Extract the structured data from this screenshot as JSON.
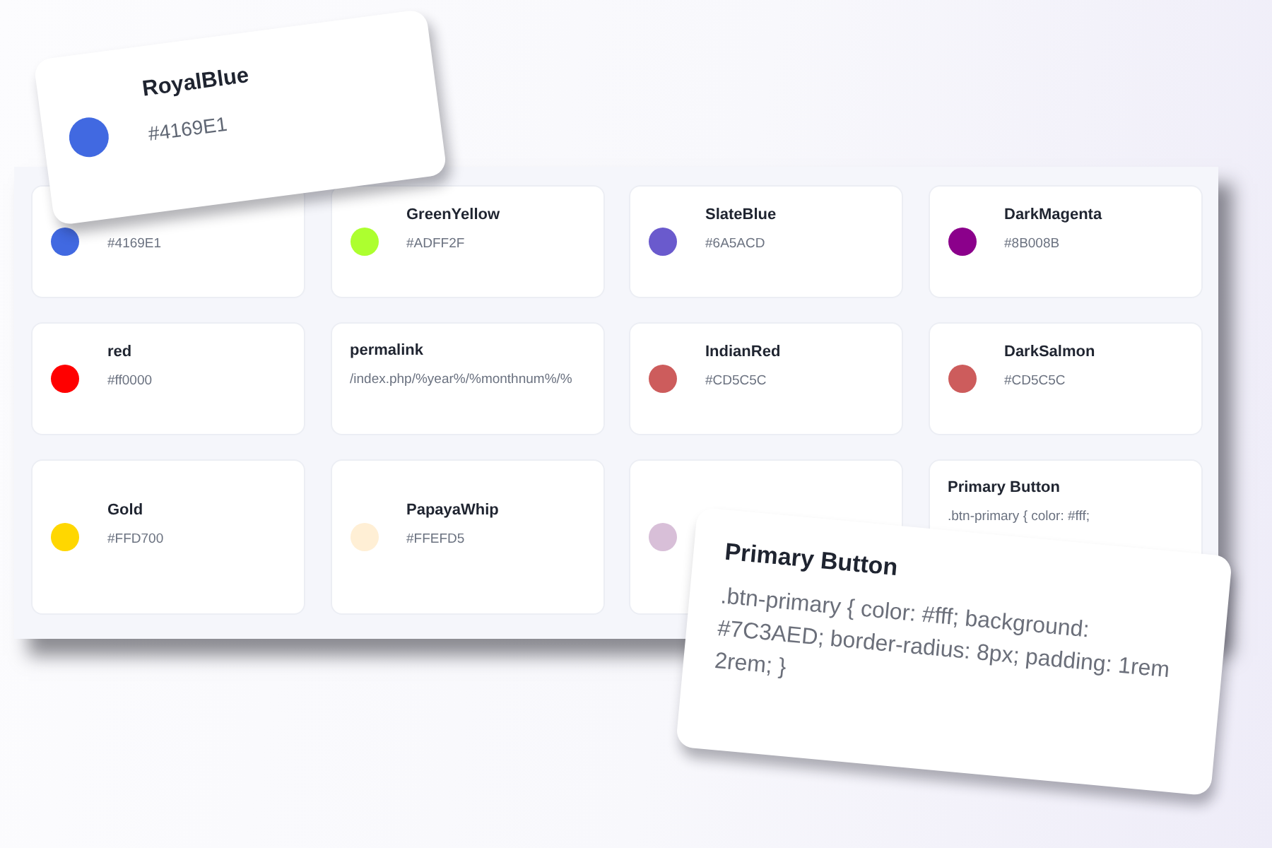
{
  "floating_cards": [
    {
      "kind": "swatch",
      "name": "RoyalBlue",
      "value": "#4169E1",
      "color": "#4169e1"
    },
    {
      "kind": "snippet",
      "name": "Primary Button",
      "value": ".btn-primary { color: #fff; background: #7C3AED; border-radius: 8px; padding: 1rem 2rem; }"
    }
  ],
  "grid": {
    "cards": [
      {
        "kind": "swatch",
        "value": "#4169E1",
        "color": "#4169e1"
      },
      {
        "kind": "swatch",
        "name": "GreenYellow",
        "value": "#ADFF2F",
        "color": "#adff2f"
      },
      {
        "kind": "swatch",
        "name": "SlateBlue",
        "value": "#6A5ACD",
        "color": "#6a5acd"
      },
      {
        "kind": "swatch",
        "name": "DarkMagenta",
        "value": "#8B008B",
        "color": "#8b008b"
      },
      {
        "kind": "swatch",
        "name": "red",
        "value": "#ff0000",
        "color": "#ff0000"
      },
      {
        "kind": "text",
        "name": "permalink",
        "value": "/index.php/%year%/%monthnum%/%"
      },
      {
        "kind": "swatch",
        "name": "IndianRed",
        "value": "#CD5C5C",
        "color": "#cd5c5c"
      },
      {
        "kind": "swatch",
        "name": "DarkSalmon",
        "value": "#CD5C5C",
        "color": "#cd5c5c"
      },
      {
        "kind": "swatch",
        "name": "Gold",
        "value": "#FFD700",
        "color": "#ffd700"
      },
      {
        "kind": "swatch",
        "name": "PapayaWhip",
        "value": "#FFEFD5",
        "color": "#ffefd5"
      },
      {
        "kind": "swatch",
        "color": "#d8bfd8"
      },
      {
        "kind": "text",
        "name": "Primary Button",
        "value": ".btn-primary { color: #fff;"
      }
    ]
  }
}
